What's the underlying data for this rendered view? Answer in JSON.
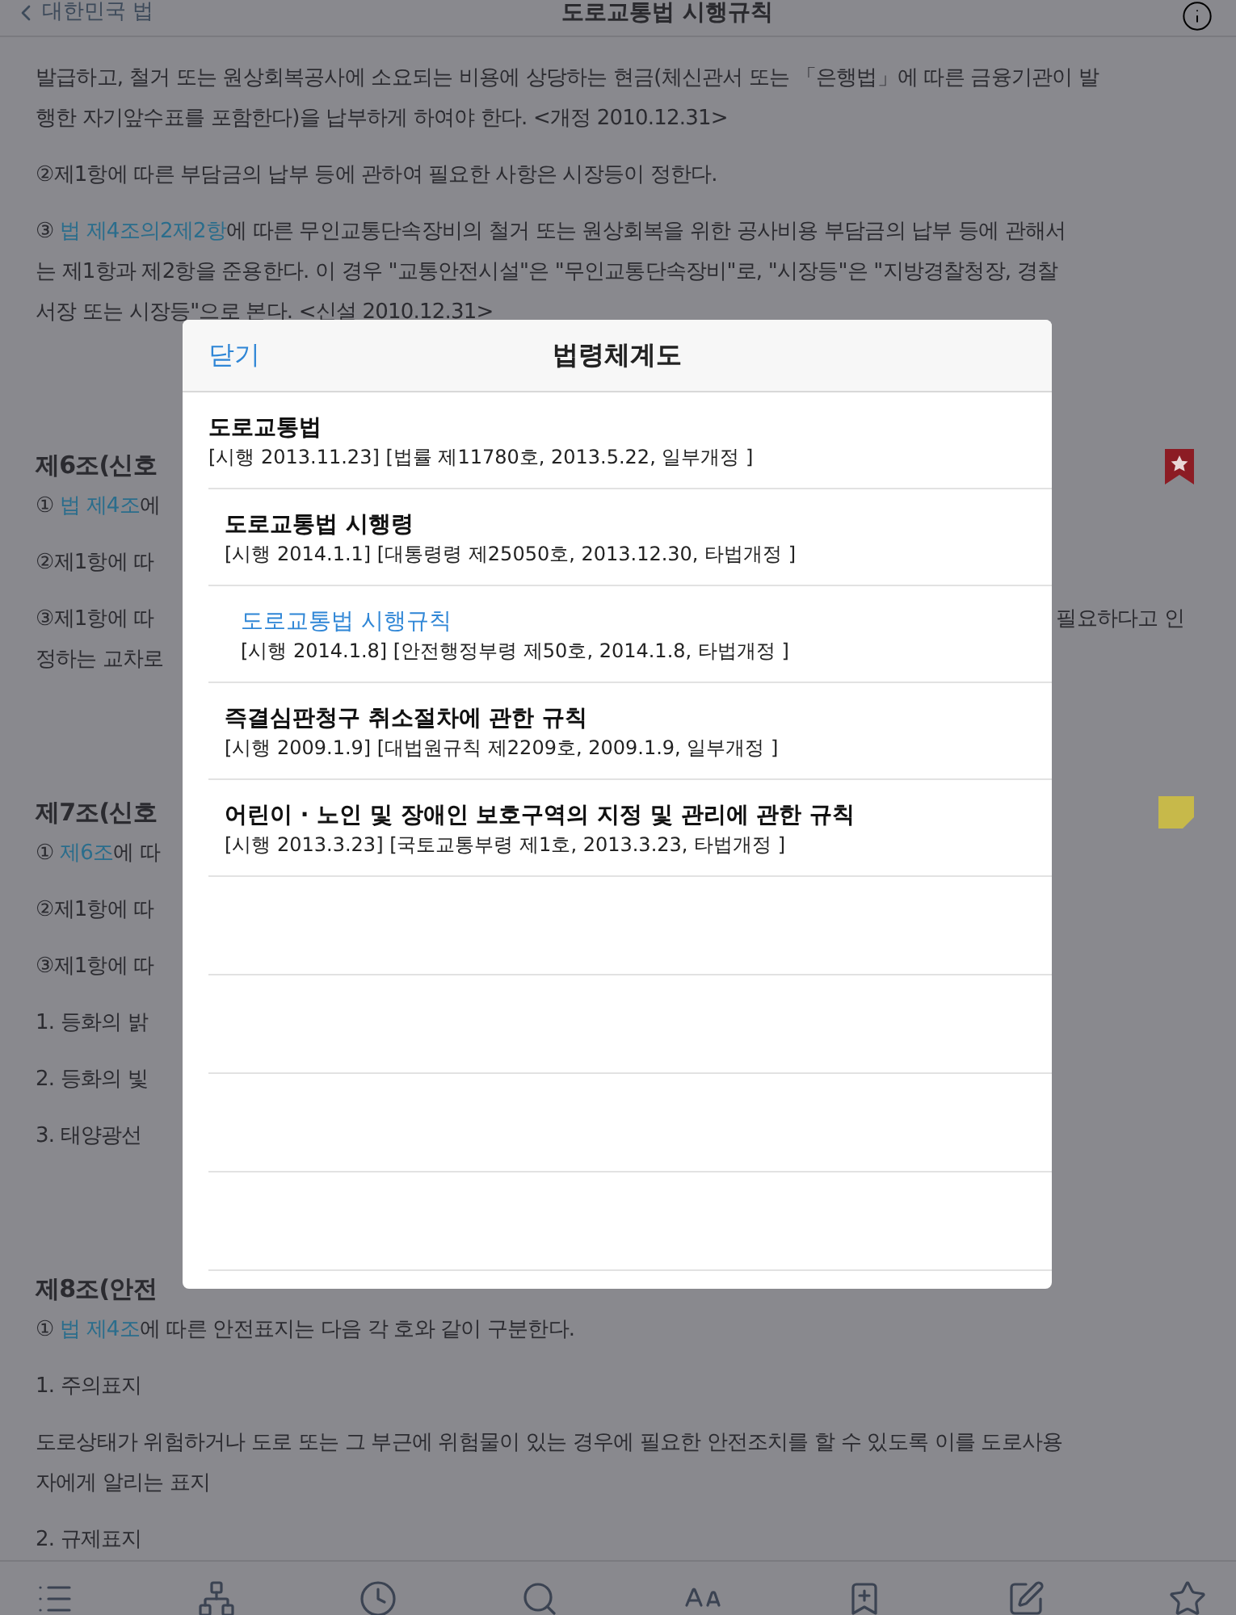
{
  "header": {
    "back_label": "대한민국 법",
    "title": "도로교통법 시행규칙"
  },
  "article": [
    {
      "kind": "paragraph",
      "lines": [
        [
          {
            "text": "발급하고, 철거 또는 원상회복공사에 소요되는 비용에 상당하는 현금(체신관서 또는 「은행법」에 따른 금융기관이 발",
            "link": false
          }
        ],
        [
          {
            "text": "행한 자기앞수표를 포함한다)을 납부하게 하여야 한다. <개정 2010.12.31>",
            "link": false
          }
        ]
      ]
    },
    {
      "kind": "paragraph",
      "lines": [
        [
          {
            "text": "②제1항에 따른 부담금의 납부 등에 관하여 필요한 사항은 시장등이 정한다.",
            "link": false
          }
        ]
      ]
    },
    {
      "kind": "paragraph",
      "lines": [
        [
          {
            "text": "③ ",
            "link": false
          },
          {
            "text": "법 제4조의2제2항",
            "link": true
          },
          {
            "text": "에 따른 무인교통단속장비의 철거 또는 원상회복을 위한 공사비용 부담금의 납부 등에 관해서",
            "link": false
          }
        ],
        [
          {
            "text": "는 제1항과 제2항을 준용한다. 이 경우 \"교통안전시설\"은 \"무인교통단속장비\"로, \"시장등\"은 \"지방경찰청장, 경찰",
            "link": false
          }
        ],
        [
          {
            "text": "서장 또는 시장등\"으로 본다. <신설 2010.12.31>",
            "link": false
          }
        ]
      ]
    },
    {
      "kind": "heading",
      "marker": {
        "kind": "bookmark"
      },
      "lines": [
        [
          {
            "text": "제6조(신호",
            "link": false
          }
        ]
      ]
    },
    {
      "kind": "paragraph",
      "lines": [
        [
          {
            "text": "① ",
            "link": false
          },
          {
            "text": "법 제4조",
            "link": true
          },
          {
            "text": "에",
            "link": false
          }
        ]
      ]
    },
    {
      "kind": "paragraph",
      "lines": [
        [
          {
            "text": "②제1항에 따",
            "link": false
          }
        ]
      ]
    },
    {
      "kind": "paragraph",
      "aside": "필요하다고 인",
      "lines": [
        [
          {
            "text": "③제1항에 따",
            "link": false
          }
        ],
        [
          {
            "text": "정하는 교차로",
            "link": false
          }
        ]
      ]
    },
    {
      "kind": "heading",
      "marker": {
        "kind": "note"
      },
      "lines": [
        [
          {
            "text": "제7조(신호",
            "link": false
          }
        ]
      ]
    },
    {
      "kind": "paragraph",
      "lines": [
        [
          {
            "text": "① ",
            "link": false
          },
          {
            "text": "제6조",
            "link": true
          },
          {
            "text": "에 따",
            "link": false
          }
        ]
      ]
    },
    {
      "kind": "paragraph",
      "lines": [
        [
          {
            "text": "②제1항에 따",
            "link": false
          }
        ]
      ]
    },
    {
      "kind": "paragraph",
      "lines": [
        [
          {
            "text": "③제1항에 따",
            "link": false
          }
        ]
      ]
    },
    {
      "kind": "paragraph",
      "lines": [
        [
          {
            "text": "1. 등화의 밝",
            "link": false
          }
        ]
      ]
    },
    {
      "kind": "paragraph",
      "lines": [
        [
          {
            "text": "2. 등화의 빛",
            "link": false
          }
        ]
      ]
    },
    {
      "kind": "paragraph",
      "lines": [
        [
          {
            "text": "3. 태양광선",
            "link": false
          }
        ]
      ]
    },
    {
      "kind": "heading",
      "lines": [
        [
          {
            "text": "제8조(안전",
            "link": false
          }
        ]
      ]
    },
    {
      "kind": "paragraph",
      "lines": [
        [
          {
            "text": "① ",
            "link": false
          },
          {
            "text": "법 제4조",
            "link": true
          },
          {
            "text": "에 따른 안전표지는 다음 각 호와 같이 구분한다.",
            "link": false
          }
        ]
      ]
    },
    {
      "kind": "paragraph",
      "lines": [
        [
          {
            "text": "1. 주의표지",
            "link": false
          }
        ]
      ]
    },
    {
      "kind": "paragraph",
      "lines": [
        [
          {
            "text": "도로상태가 위험하거나 도로 또는 그 부근에 위험물이 있는 경우에 필요한 안전조치를 할 수 있도록 이를 도로사용",
            "link": false
          }
        ],
        [
          {
            "text": "자에게 알리는 표지",
            "link": false
          }
        ]
      ]
    },
    {
      "kind": "paragraph",
      "lines": [
        [
          {
            "text": "2. 규제표지",
            "link": false
          }
        ]
      ]
    }
  ],
  "dialog": {
    "close_label": "닫기",
    "title": "법령체계도",
    "items": [
      {
        "name": "도로교통법",
        "meta": "[시행 2013.11.23] [법률 제11780호, 2013.5.22, 일부개정 ]",
        "selected": false,
        "children": [
          {
            "name": "도로교통법 시행령",
            "meta": "[시행 2014.1.1] [대통령령 제25050호, 2013.12.30, 타법개정 ]",
            "selected": false,
            "children": [
              {
                "name": "도로교통법 시행규칙",
                "meta": "[시행 2014.1.8] [안전행정부령 제50호, 2014.1.8, 타법개정 ]",
                "selected": true
              }
            ]
          },
          {
            "name": "즉결심판청구 취소절차에 관한 규칙",
            "meta": "[시행 2009.1.9] [대법원규칙 제2209호, 2009.1.9, 일부개정 ]",
            "selected": false
          },
          {
            "name": "어린이 · 노인 및 장애인 보호구역의 지정 및 관리에 관한 규칙",
            "meta": "[시행 2013.3.23] [국토교통부령 제1호, 2013.3.23, 타법개정 ]",
            "selected": false
          }
        ]
      }
    ]
  },
  "toolbar": [
    {
      "kind": "list"
    },
    {
      "kind": "hierarchy"
    },
    {
      "kind": "history"
    },
    {
      "kind": "search"
    },
    {
      "kind": "font"
    },
    {
      "kind": "bookmark"
    },
    {
      "kind": "memo"
    },
    {
      "kind": "favorite"
    }
  ]
}
